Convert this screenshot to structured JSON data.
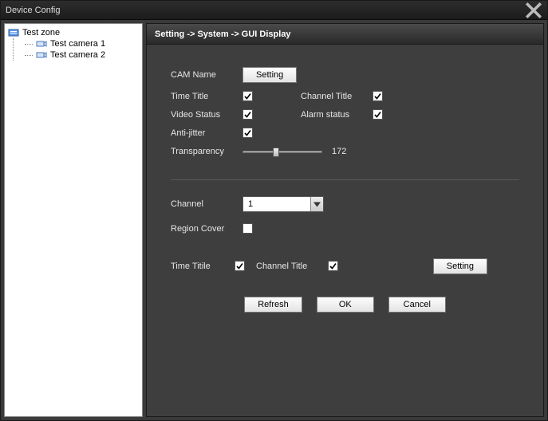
{
  "window": {
    "title": "Device Config"
  },
  "tree": {
    "root": {
      "label": "Test zone"
    },
    "items": [
      {
        "label": "Test camera 1"
      },
      {
        "label": "Test camera 2"
      }
    ]
  },
  "breadcrumb": "Setting -> System -> GUI Display",
  "group1": {
    "cam_name_label": "CAM Name",
    "setting_btn": "Setting",
    "time_title_label": "Time Title",
    "channel_title_label": "Channel Title",
    "video_status_label": "Video Status",
    "alarm_status_label": "Alarm status",
    "anti_jitter_label": "Anti-jitter",
    "transparency_label": "Transparency",
    "transparency_value": "172",
    "time_title_checked": true,
    "channel_title_checked": true,
    "video_status_checked": true,
    "alarm_status_checked": true,
    "anti_jitter_checked": true
  },
  "group2": {
    "channel_label": "Channel",
    "channel_value": "1",
    "region_cover_label": "Region Cover",
    "region_cover_checked": false,
    "time_title_label": "Time Titile",
    "time_title_checked": true,
    "channel_title_label": "Channel Title",
    "channel_title_checked": true,
    "setting_btn": "Setting"
  },
  "footer": {
    "refresh": "Refresh",
    "ok": "OK",
    "cancel": "Cancel"
  }
}
